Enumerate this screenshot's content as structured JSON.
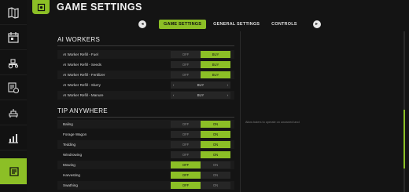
{
  "header": {
    "title": "GAME SETTINGS"
  },
  "tabs": [
    {
      "label": "GAME SETTINGS",
      "active": true
    },
    {
      "label": "GENERAL SETTINGS",
      "active": false
    },
    {
      "label": "CONTROLS",
      "active": false
    }
  ],
  "sidebar": {
    "items": [
      {
        "icon": "map-icon"
      },
      {
        "icon": "calendar-icon"
      },
      {
        "icon": "tractor-icon"
      },
      {
        "icon": "finance-icon"
      },
      {
        "icon": "animals-icon"
      },
      {
        "icon": "statistics-icon"
      },
      {
        "icon": "settings-icon",
        "active": true
      }
    ]
  },
  "sections": {
    "ai_workers": {
      "title": "AI WORKERS",
      "rows": [
        {
          "label": "AI Worker Refill - Fuel",
          "type": "toggle",
          "off": "OFF",
          "on": "BUY",
          "value": "on"
        },
        {
          "label": "AI Worker Refill - Seeds",
          "type": "toggle",
          "off": "OFF",
          "on": "BUY",
          "value": "on"
        },
        {
          "label": "AI Worker Refill - Fertilizer",
          "type": "toggle",
          "off": "OFF",
          "on": "BUY",
          "value": "on"
        },
        {
          "label": "AI Worker Refill - Slurry",
          "type": "select",
          "value": "BUY"
        },
        {
          "label": "AI Worker Refill - Manure",
          "type": "select",
          "value": "BUY"
        }
      ]
    },
    "tip_anywhere": {
      "title": "TIP ANYWHERE",
      "rows": [
        {
          "label": "Baling",
          "off": "OFF",
          "on": "ON",
          "value": "on"
        },
        {
          "label": "Forage Wagon",
          "off": "OFF",
          "on": "ON",
          "value": "on"
        },
        {
          "label": "Tedding",
          "off": "OFF",
          "on": "ON",
          "value": "on"
        },
        {
          "label": "Windrowing",
          "off": "OFF",
          "on": "ON",
          "value": "on"
        },
        {
          "label": "Mowing",
          "off": "OFF",
          "on": "ON",
          "value": "off"
        },
        {
          "label": "Harvesting",
          "off": "OFF",
          "on": "ON",
          "value": "off"
        },
        {
          "label": "Swathing",
          "off": "OFF",
          "on": "ON",
          "value": "off"
        }
      ]
    }
  },
  "description": "Allow balers to operate on unowned land",
  "colors": {
    "accent": "#8cbf26",
    "background": "#141414",
    "sidebar": "#121212"
  },
  "tabbar_nav": {
    "left": "◂",
    "right": "▸"
  }
}
